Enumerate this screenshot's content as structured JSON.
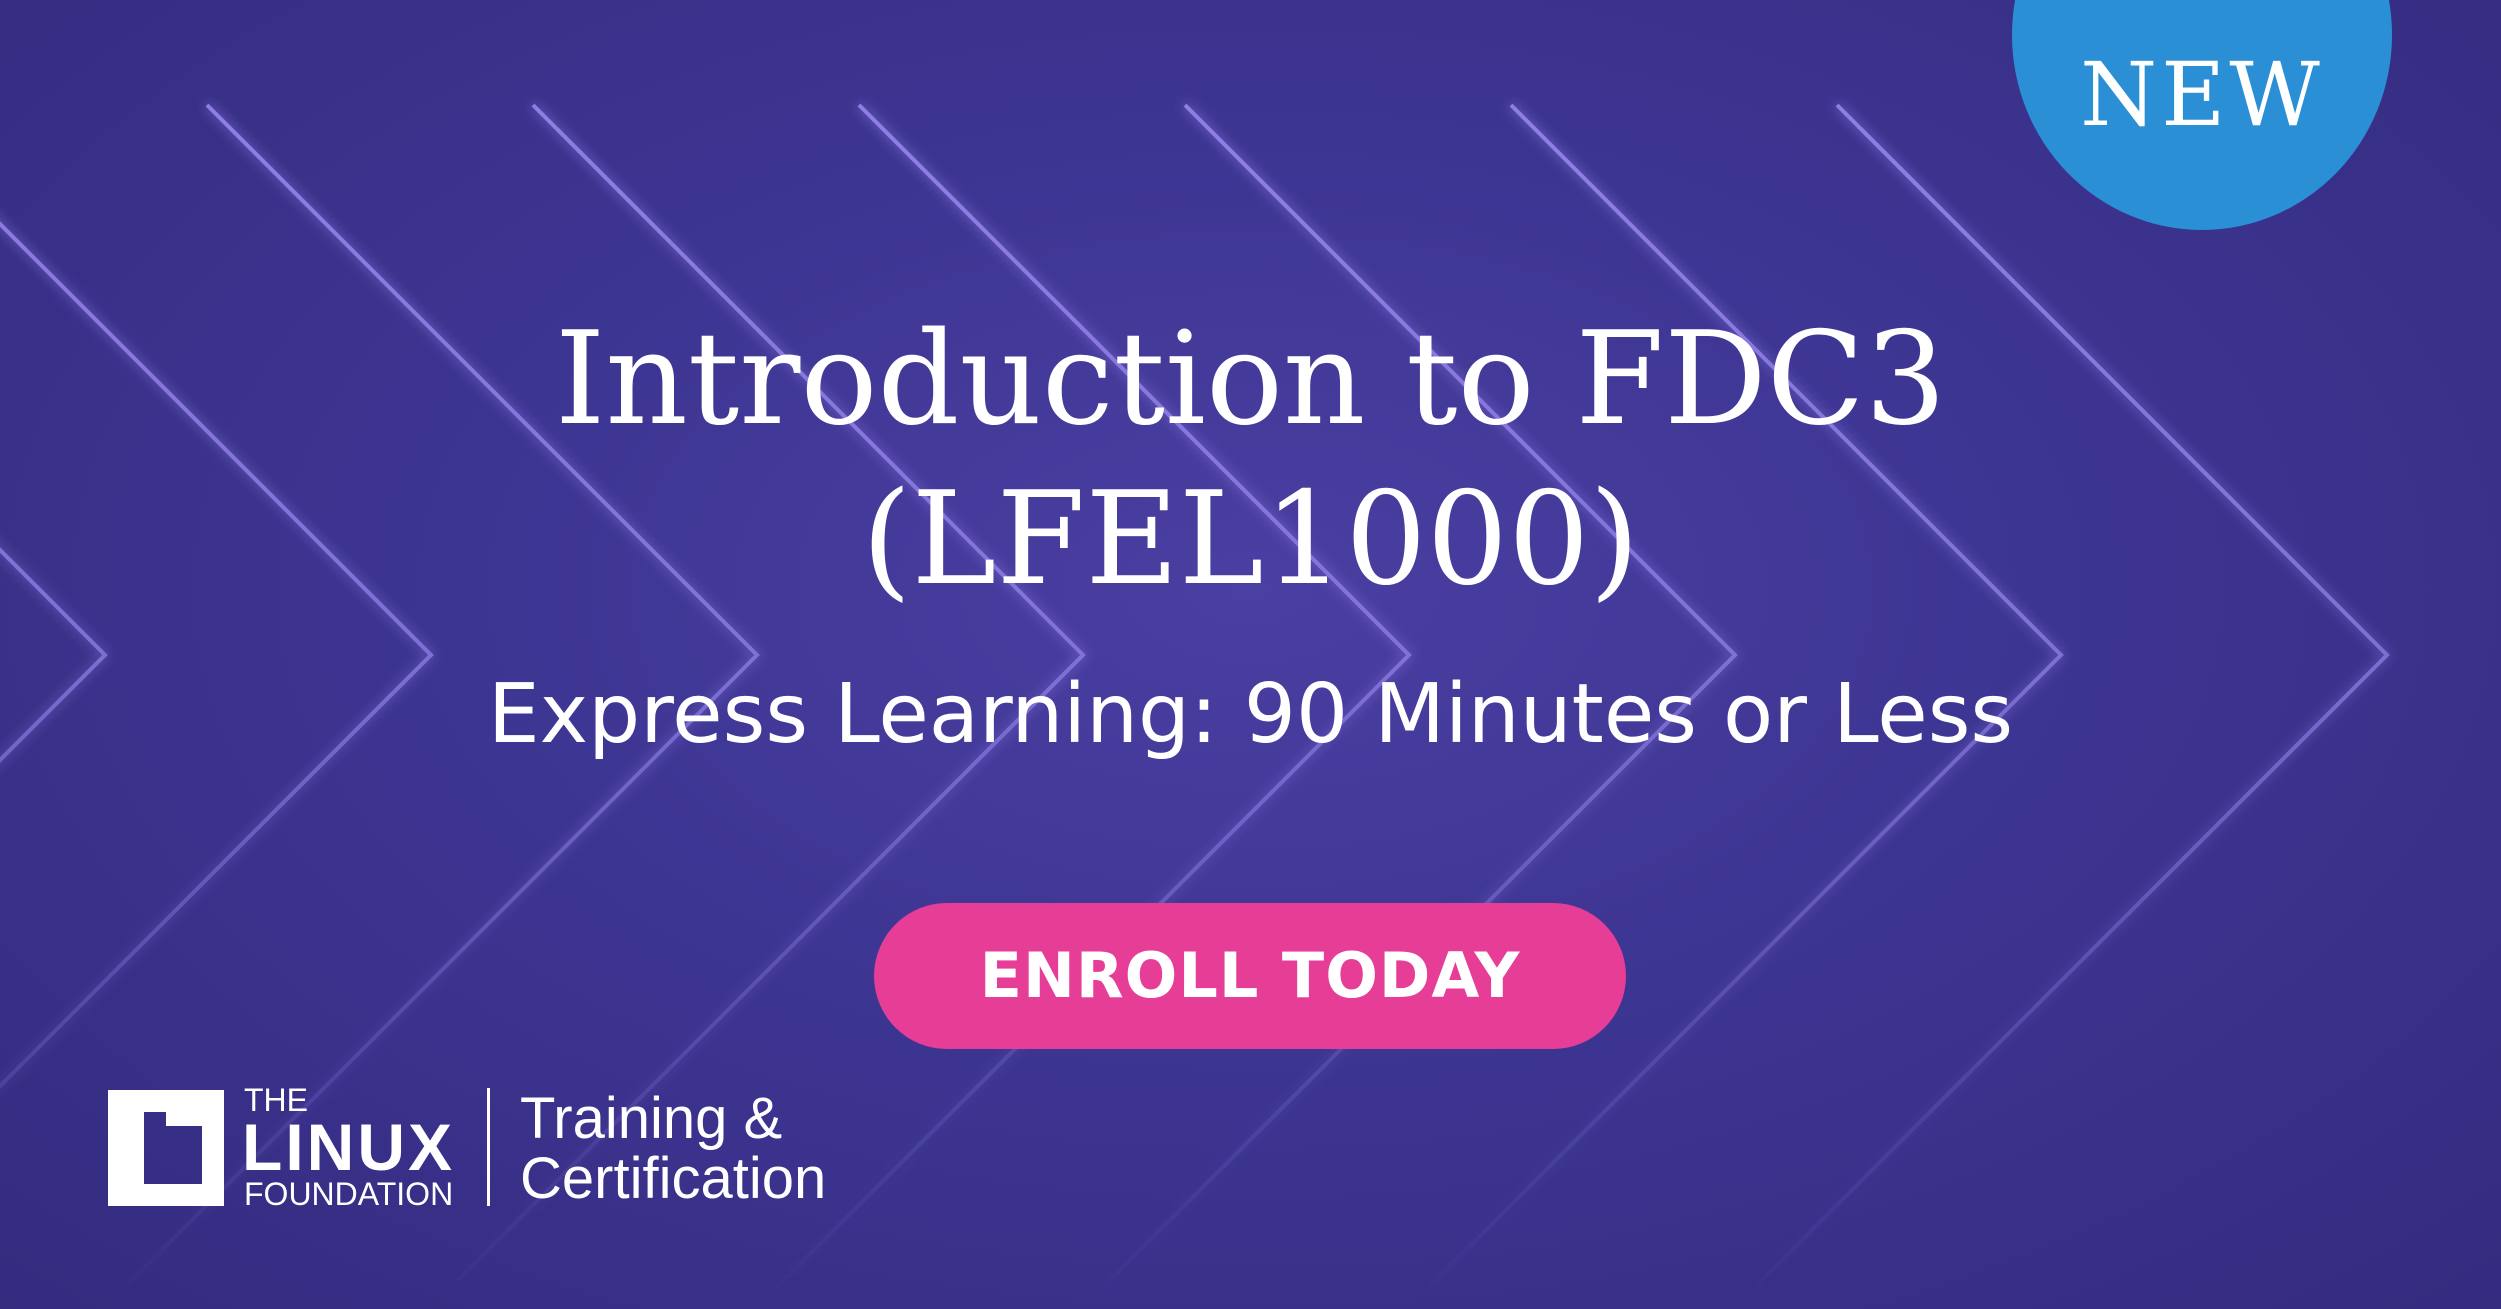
{
  "badge": {
    "label": "NEW",
    "color": "#2b8fd6"
  },
  "course": {
    "title_line1": "Introduction to FDC3",
    "title_line2": "(LFEL1000)",
    "subtitle": "Express Learning: 90 Minutes or Less"
  },
  "cta": {
    "label": "ENROLL TODAY",
    "color": "#e63d96"
  },
  "logo": {
    "the": "THE",
    "linux": "LINUX",
    "foundation": "FOUNDATION",
    "program_line1": "Training &",
    "program_line2": "Certification"
  },
  "colors": {
    "background": "#3d3592",
    "chevron": "#8a78e6"
  }
}
